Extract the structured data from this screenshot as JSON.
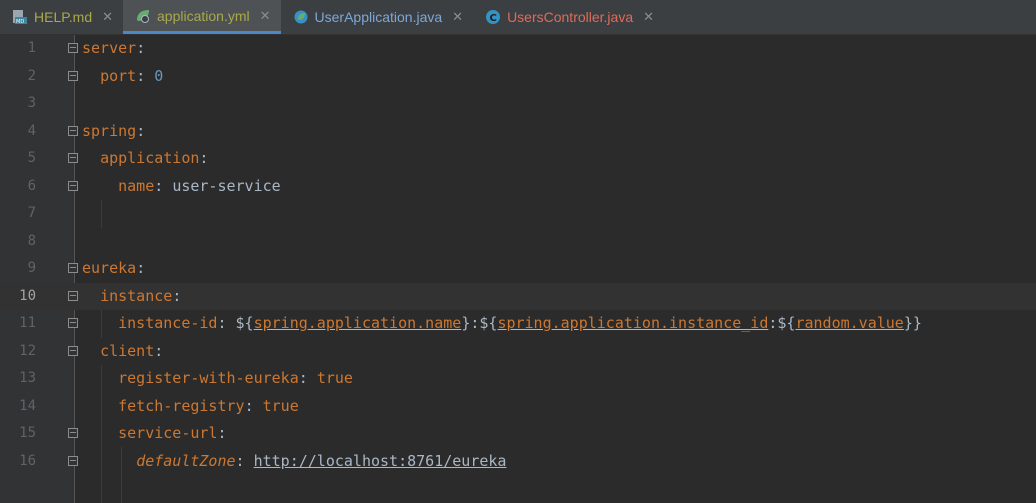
{
  "tabs": [
    {
      "label": "HELP.md",
      "color": "#a9a94a",
      "icon": "markdown-file-icon"
    },
    {
      "label": "application.yml",
      "color": "#a9a94a",
      "icon": "spring-yaml-icon",
      "active": true
    },
    {
      "label": "UserApplication.java",
      "color": "#7ea7d8",
      "icon": "spring-boot-class-icon"
    },
    {
      "label": "UsersController.java",
      "color": "#de6b5a",
      "icon": "java-class-icon"
    }
  ],
  "tab_close_glyph": "✕",
  "editor": {
    "current_line": 10,
    "lines": [
      {
        "n": "1",
        "segs": [
          {
            "t": "server",
            "c": "k"
          },
          {
            "t": ":",
            "c": "p"
          }
        ]
      },
      {
        "n": "2",
        "segs": [
          {
            "t": "  "
          },
          {
            "t": "port",
            "c": "k"
          },
          {
            "t": ": ",
            "c": "p"
          },
          {
            "t": "0",
            "c": "n"
          }
        ]
      },
      {
        "n": "3",
        "segs": []
      },
      {
        "n": "4",
        "segs": [
          {
            "t": "spring",
            "c": "k"
          },
          {
            "t": ":",
            "c": "p"
          }
        ]
      },
      {
        "n": "5",
        "segs": [
          {
            "t": "  "
          },
          {
            "t": "application",
            "c": "k"
          },
          {
            "t": ":",
            "c": "p"
          }
        ]
      },
      {
        "n": "6",
        "segs": [
          {
            "t": "    "
          },
          {
            "t": "name",
            "c": "k"
          },
          {
            "t": ": ",
            "c": "p"
          },
          {
            "t": "user-service",
            "c": "v"
          }
        ]
      },
      {
        "n": "7",
        "segs": []
      },
      {
        "n": "8",
        "segs": []
      },
      {
        "n": "9",
        "segs": [
          {
            "t": "eureka",
            "c": "k"
          },
          {
            "t": ":",
            "c": "p"
          }
        ]
      },
      {
        "n": "10",
        "segs": [
          {
            "t": "  "
          },
          {
            "t": "instance",
            "c": "k"
          },
          {
            "t": ":",
            "c": "p"
          }
        ]
      },
      {
        "n": "11",
        "segs": [
          {
            "t": "    "
          },
          {
            "t": "instance-id",
            "c": "k"
          },
          {
            "t": ": ${",
            "c": "p"
          },
          {
            "t": "spring.application.name",
            "c": "ref"
          },
          {
            "t": "}:${",
            "c": "p"
          },
          {
            "t": "spring.application.instance_id",
            "c": "ref"
          },
          {
            "t": ":${",
            "c": "p"
          },
          {
            "t": "random.value",
            "c": "ref"
          },
          {
            "t": "}}",
            "c": "p"
          }
        ]
      },
      {
        "n": "12",
        "segs": [
          {
            "t": "  "
          },
          {
            "t": "client",
            "c": "k"
          },
          {
            "t": ":",
            "c": "p"
          }
        ]
      },
      {
        "n": "13",
        "segs": [
          {
            "t": "    "
          },
          {
            "t": "register-with-eureka",
            "c": "k"
          },
          {
            "t": ": ",
            "c": "p"
          },
          {
            "t": "true",
            "c": "k"
          }
        ]
      },
      {
        "n": "14",
        "segs": [
          {
            "t": "    "
          },
          {
            "t": "fetch-registry",
            "c": "k"
          },
          {
            "t": ": ",
            "c": "p"
          },
          {
            "t": "true",
            "c": "k"
          }
        ]
      },
      {
        "n": "15",
        "segs": [
          {
            "t": "    "
          },
          {
            "t": "service-url",
            "c": "k"
          },
          {
            "t": ":",
            "c": "p"
          }
        ]
      },
      {
        "n": "16",
        "segs": [
          {
            "t": "      "
          },
          {
            "t": "defaultZone",
            "c": "it"
          },
          {
            "t": ": ",
            "c": "p"
          },
          {
            "t": "http://localhost:8761/eureka",
            "c": "url"
          }
        ]
      }
    ]
  }
}
